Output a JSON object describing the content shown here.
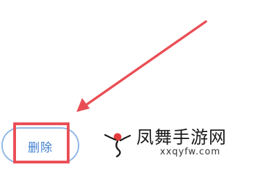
{
  "actions": {
    "delete_label": "删除"
  },
  "annotation": {
    "highlight_color": "#ea4e55",
    "arrow_color": "#ea4e55",
    "arrow_icon": "annotation-arrow-icon"
  },
  "button_colors": {
    "border": "#8fb6e6",
    "text": "#3f7fd0"
  },
  "watermark": {
    "name": "凤舞手游网",
    "domain": "xxqyfw.com",
    "logo_icon": "phoenix-logo-icon"
  }
}
